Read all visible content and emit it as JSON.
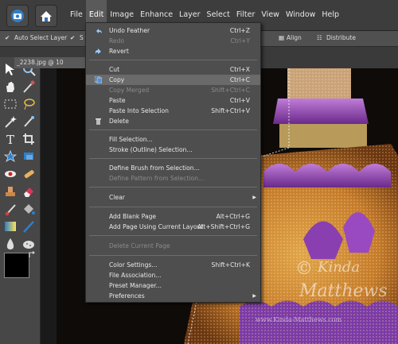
{
  "menubar": {
    "items": [
      "File",
      "Edit",
      "Image",
      "Enhance",
      "Layer",
      "Select",
      "Filter",
      "View",
      "Window",
      "Help"
    ],
    "active": "Edit"
  },
  "options_bar": {
    "auto_select_layer": "Auto Select Layer",
    "s_label": "S",
    "align": "Align",
    "distribute": "Distribute"
  },
  "document": {
    "tab": "_2238.jpg @ 10"
  },
  "edit_menu": {
    "items": [
      {
        "label": "Undo Feather",
        "shortcut": "Ctrl+Z"
      },
      {
        "label": "Redo",
        "shortcut": "Ctrl+Y"
      },
      {
        "label": "Revert",
        "shortcut": ""
      },
      {
        "label": "Cut",
        "shortcut": "Ctrl+X"
      },
      {
        "label": "Copy",
        "shortcut": "Ctrl+C"
      },
      {
        "label": "Copy Merged",
        "shortcut": "Shift+Ctrl+C"
      },
      {
        "label": "Paste",
        "shortcut": "Ctrl+V"
      },
      {
        "label": "Paste Into Selection",
        "shortcut": "Shift+Ctrl+V"
      },
      {
        "label": "Delete",
        "shortcut": ""
      },
      {
        "label": "Fill Selection...",
        "shortcut": ""
      },
      {
        "label": "Stroke (Outline) Selection...",
        "shortcut": ""
      },
      {
        "label": "Define Brush from Selection...",
        "shortcut": ""
      },
      {
        "label": "Define Pattern from Selection...",
        "shortcut": ""
      },
      {
        "label": "Clear",
        "shortcut": ""
      },
      {
        "label": "Add Blank Page",
        "shortcut": "Alt+Ctrl+G"
      },
      {
        "label": "Add Page Using Current Layout",
        "shortcut": "Alt+Shift+Ctrl+G"
      },
      {
        "label": "Delete Current Page",
        "shortcut": ""
      },
      {
        "label": "Color Settings...",
        "shortcut": "Shift+Ctrl+K"
      },
      {
        "label": "File Association...",
        "shortcut": ""
      },
      {
        "label": "Preset Manager...",
        "shortcut": ""
      },
      {
        "label": "Preferences",
        "shortcut": ""
      }
    ],
    "highlighted": "Copy",
    "disabled": [
      "Redo",
      "Copy Merged",
      "Define Pattern from Selection...",
      "Delete Current Page"
    ]
  },
  "watermark": {
    "symbol": "©",
    "line1": "Kinda",
    "line2": "Matthews",
    "footer": "www.Kinda-Matthews.com"
  },
  "colors": {
    "menubar": "#3d3d3d",
    "menu_bg": "#4e4e4e",
    "highlight": "#6a6a6a",
    "accent_blue": "#2f7fc8"
  }
}
